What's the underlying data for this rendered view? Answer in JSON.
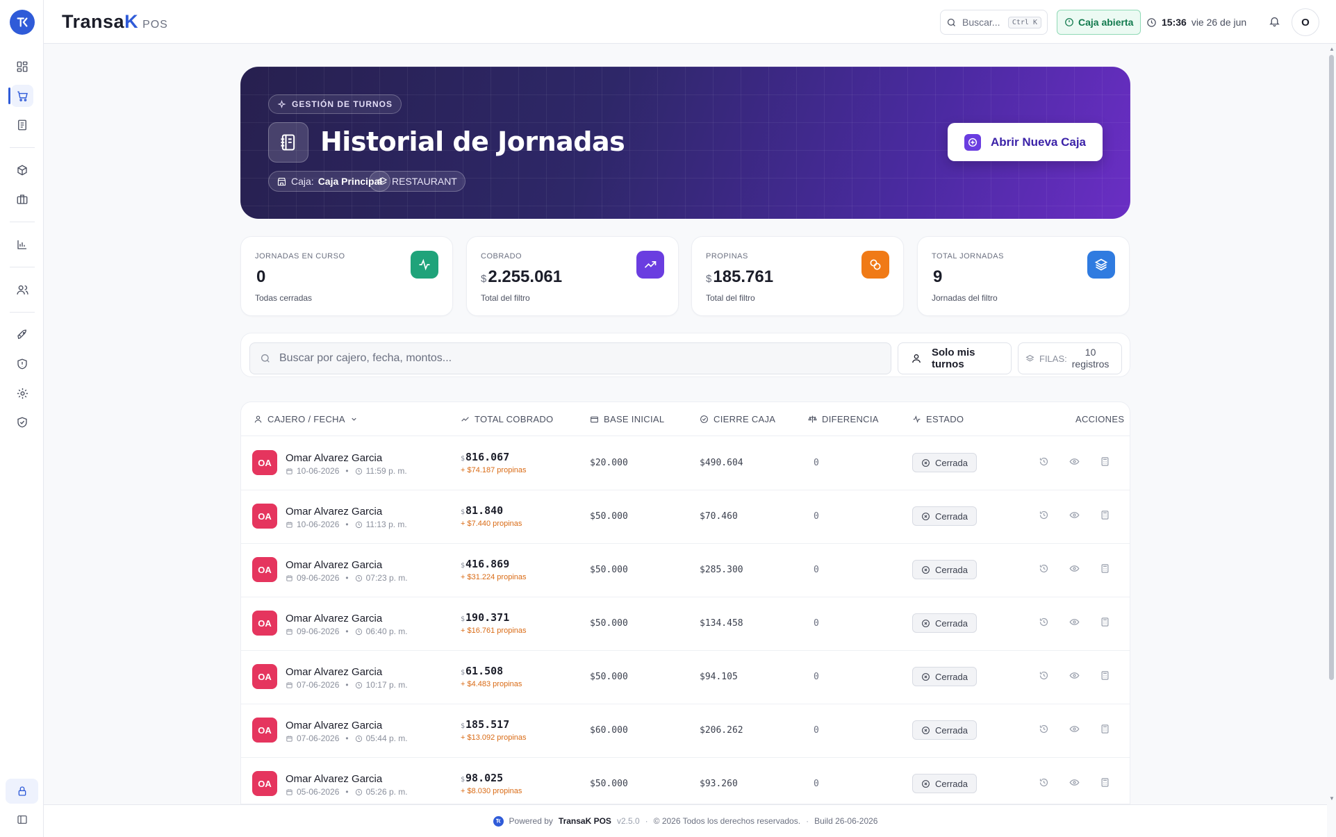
{
  "app": {
    "brand_main": "Transa",
    "brand_k": "K",
    "brand_suffix": "POS"
  },
  "topbar": {
    "search_placeholder": "Buscar...",
    "shortcut": "Ctrl K",
    "caja_status": "Caja abierta",
    "time": "15:36",
    "date": "vie 26 de jun",
    "user_initial": "O"
  },
  "hero": {
    "chip": "GESTIÓN DE TURNOS",
    "title": "Historial de Jornadas",
    "caja_label": "Caja:",
    "caja_value": "Caja Principal",
    "mode": "RESTAURANT",
    "open_button": "Abrir Nueva Caja"
  },
  "stats": [
    {
      "label": "JORNADAS EN CURSO",
      "value": "0",
      "currency": "",
      "sub": "Todas cerradas",
      "icon": "activity-icon",
      "color": "#1fa37a"
    },
    {
      "label": "COBRADO",
      "value": "2.255.061",
      "currency": "$",
      "sub": "Total del filtro",
      "icon": "trending-up-icon",
      "color": "#6a3de0"
    },
    {
      "label": "PROPINAS",
      "value": "185.761",
      "currency": "$",
      "sub": "Total del filtro",
      "icon": "coins-icon",
      "color": "#f07a16"
    },
    {
      "label": "TOTAL JORNADAS",
      "value": "9",
      "currency": "",
      "sub": "Jornadas del filtro",
      "icon": "layers-icon",
      "color": "#2f7be0"
    }
  ],
  "filters": {
    "search_placeholder": "Buscar por cajero, fecha, montos...",
    "solo_label": "Solo mis turnos",
    "filas_label": "FILAS:",
    "filas_value_1": "10",
    "filas_value_2": "registros"
  },
  "table": {
    "headers": [
      "CAJERO / FECHA",
      "TOTAL COBRADO",
      "BASE INICIAL",
      "CIERRE CAJA",
      "DIFERENCIA",
      "ESTADO",
      "ACCIONES"
    ],
    "rows": [
      {
        "initials": "OA",
        "name": "Omar Alvarez Garcia",
        "date": "10-06-2026",
        "time": "11:59 p. m.",
        "total": "816.067",
        "tips": "+ $74.187 propinas",
        "base": "$20.000",
        "cierre": "$490.604",
        "diff": "0",
        "status": "Cerrada"
      },
      {
        "initials": "OA",
        "name": "Omar Alvarez Garcia",
        "date": "10-06-2026",
        "time": "11:13 p. m.",
        "total": "81.840",
        "tips": "+ $7.440 propinas",
        "base": "$50.000",
        "cierre": "$70.460",
        "diff": "0",
        "status": "Cerrada"
      },
      {
        "initials": "OA",
        "name": "Omar Alvarez Garcia",
        "date": "09-06-2026",
        "time": "07:23 p. m.",
        "total": "416.869",
        "tips": "+ $31.224 propinas",
        "base": "$50.000",
        "cierre": "$285.300",
        "diff": "0",
        "status": "Cerrada"
      },
      {
        "initials": "OA",
        "name": "Omar Alvarez Garcia",
        "date": "09-06-2026",
        "time": "06:40 p. m.",
        "total": "190.371",
        "tips": "+ $16.761 propinas",
        "base": "$50.000",
        "cierre": "$134.458",
        "diff": "0",
        "status": "Cerrada"
      },
      {
        "initials": "OA",
        "name": "Omar Alvarez Garcia",
        "date": "07-06-2026",
        "time": "10:17 p. m.",
        "total": "61.508",
        "tips": "+ $4.483 propinas",
        "base": "$50.000",
        "cierre": "$94.105",
        "diff": "0",
        "status": "Cerrada"
      },
      {
        "initials": "OA",
        "name": "Omar Alvarez Garcia",
        "date": "07-06-2026",
        "time": "05:44 p. m.",
        "total": "185.517",
        "tips": "+ $13.092 propinas",
        "base": "$60.000",
        "cierre": "$206.262",
        "diff": "0",
        "status": "Cerrada"
      },
      {
        "initials": "OA",
        "name": "Omar Alvarez Garcia",
        "date": "05-06-2026",
        "time": "05:26 p. m.",
        "total": "98.025",
        "tips": "+ $8.030 propinas",
        "base": "$50.000",
        "cierre": "$93.260",
        "diff": "0",
        "status": "Cerrada"
      }
    ]
  },
  "footer": {
    "powered": "Powered by",
    "brand": "TransaK POS",
    "version": "v2.5.0",
    "rights": "© 2026 Todos los derechos reservados.",
    "build": "Build 26-06-2026"
  },
  "colors": {
    "accent": "#2f5bd8",
    "avatar": "#e5355e",
    "tips": "#d96a14",
    "caja_open": "#127a4e"
  }
}
